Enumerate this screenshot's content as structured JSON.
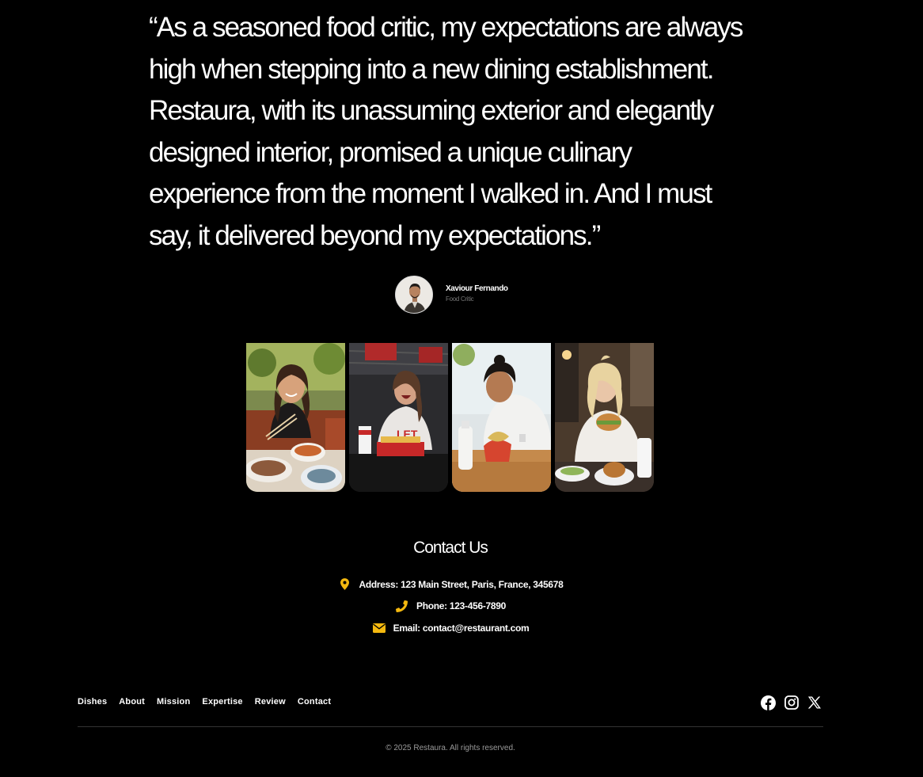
{
  "testimonial": {
    "quote": "“As a seasoned food critic, my expectations are always high when stepping into a new dining establishment. Restaura, with its unassuming exterior and elegantly designed interior, promised a unique culinary experience from the moment I walked in. And I must say, it delivered beyond my expectations.”",
    "author_name": "Xaviour Fernando",
    "author_role": "Food Critic"
  },
  "gallery": {
    "photos": [
      {
        "icon": "woman-with-chopsticks-photo"
      },
      {
        "icon": "woman-eating-fries-photo"
      },
      {
        "icon": "woman-eating-taco-photo"
      },
      {
        "icon": "woman-eating-burger-photo"
      }
    ]
  },
  "contact": {
    "title": "Contact Us",
    "address": "Address: 123 Main Street, Paris, France, 345678",
    "phone": "Phone: 123-456-7890",
    "email": "Email: contact@restaurant.com",
    "icon_color": "#f4b80f"
  },
  "footer": {
    "nav": [
      "Dishes",
      "About",
      "Mission",
      "Expertise",
      "Review",
      "Contact"
    ],
    "socials": [
      "facebook-icon",
      "instagram-icon",
      "x-icon"
    ],
    "copyright": "© 2025 Restaura. All rights reserved."
  }
}
